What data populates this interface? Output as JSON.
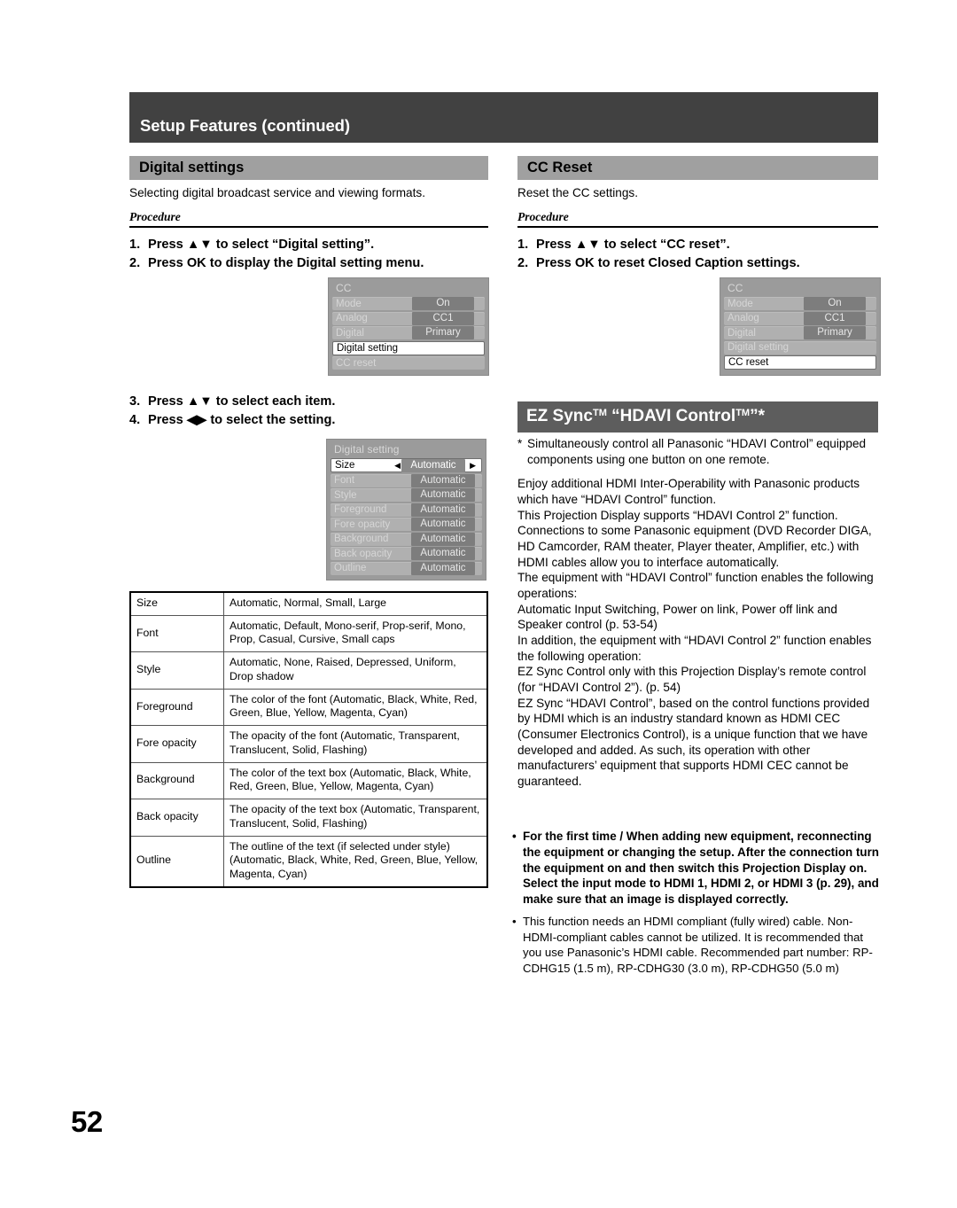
{
  "header": {
    "chapter_title": "Setup Features (continued)"
  },
  "page_number": "52",
  "left_column": {
    "section_title": "Digital settings",
    "description": "Selecting digital broadcast service and viewing formats.",
    "procedure_label": "Procedure",
    "steps_a": [
      {
        "num": "1.",
        "text": "Press ▲▼ to select “Digital setting”."
      },
      {
        "num": "2.",
        "text": "Press OK to display the Digital setting menu."
      }
    ],
    "steps_b": [
      {
        "num": "3.",
        "text": "Press ▲▼ to select each item."
      },
      {
        "num": "4.",
        "text": "Press ◀▶ to select the setting."
      }
    ],
    "cc_menu": {
      "title": "CC",
      "rows": [
        {
          "label": "Mode",
          "value": "On",
          "selected": false
        },
        {
          "label": "Analog",
          "value": "CC1",
          "selected": false
        },
        {
          "label": "Digital",
          "value": "Primary",
          "selected": false
        },
        {
          "label": "Digital setting",
          "value": "",
          "selected": true
        },
        {
          "label": "CC reset",
          "value": "",
          "selected": false
        }
      ]
    },
    "digital_setting_menu": {
      "title": "Digital setting",
      "left_arrow": "◀",
      "right_arrow": "▶",
      "rows": [
        {
          "label": "Size",
          "value": "Automatic",
          "selected": true
        },
        {
          "label": "Font",
          "value": "Automatic",
          "selected": false
        },
        {
          "label": "Style",
          "value": "Automatic",
          "selected": false
        },
        {
          "label": "Foreground",
          "value": "Automatic",
          "selected": false
        },
        {
          "label": "Fore opacity",
          "value": "Automatic",
          "selected": false
        },
        {
          "label": "Background",
          "value": "Automatic",
          "selected": false
        },
        {
          "label": "Back opacity",
          "value": "Automatic",
          "selected": false
        },
        {
          "label": "Outline",
          "value": "Automatic",
          "selected": false
        }
      ]
    },
    "spec_table": {
      "rows": [
        {
          "key": "Size",
          "value": "Automatic, Normal, Small, Large"
        },
        {
          "key": "Font",
          "value": "Automatic, Default, Mono-serif, Prop-serif, Mono, Prop, Casual, Cursive, Small caps"
        },
        {
          "key": "Style",
          "value": "Automatic, None, Raised, Depressed, Uniform, Drop shadow"
        },
        {
          "key": "Foreground",
          "value": "The color of the font (Automatic, Black, White, Red, Green, Blue, Yellow, Magenta, Cyan)"
        },
        {
          "key": "Fore opacity",
          "value": "The opacity of the font (Automatic, Transparent, Translucent, Solid, Flashing)"
        },
        {
          "key": "Background",
          "value": "The color of the text box (Automatic, Black, White, Red, Green, Blue, Yellow, Magenta, Cyan)"
        },
        {
          "key": "Back opacity",
          "value": "The opacity of the text box (Automatic, Transparent, Translucent, Solid, Flashing)"
        },
        {
          "key": "Outline",
          "value": "The outline of the text (if selected under style) (Automatic, Black, White, Red, Green, Blue, Yellow, Magenta, Cyan)"
        }
      ]
    }
  },
  "right_column": {
    "section_title": "CC Reset",
    "description": "Reset the CC settings.",
    "procedure_label": "Procedure",
    "steps": [
      {
        "num": "1.",
        "text": "Press ▲▼ to select “CC reset”."
      },
      {
        "num": "2.",
        "text": "Press OK to reset Closed Caption settings."
      }
    ],
    "cc_menu": {
      "title": "CC",
      "rows": [
        {
          "label": "Mode",
          "value": "On",
          "selected": false
        },
        {
          "label": "Analog",
          "value": "CC1",
          "selected": false
        },
        {
          "label": "Digital",
          "value": "Primary",
          "selected": false
        },
        {
          "label": "Digital setting",
          "value": "",
          "selected": false
        },
        {
          "label": "CC reset",
          "value": "",
          "selected": true
        }
      ]
    },
    "ez_sync": {
      "title_main": "EZ Sync",
      "title_tm1": "TM",
      "title_mid": " “HDAVI Control",
      "title_tm2": "TM",
      "title_end": "”*",
      "footnote_star": "*",
      "footnote_text": "Simultaneously control all Panasonic “HDAVI Control” equipped components using one button on one remote.",
      "paragraphs": [
        "Enjoy additional HDMI Inter-Operability with Panasonic products which have “HDAVI Control” function.",
        "This Projection Display supports “HDAVI Control 2” function.",
        "Connections to some Panasonic equipment (DVD Recorder DIGA, HD Camcorder, RAM theater, Player theater, Amplifier, etc.) with HDMI cables allow you to interface automatically.",
        "The equipment with “HDAVI Control” function enables the following operations:",
        "Automatic Input Switching, Power on link, Power off link and Speaker control (p. 53-54)",
        "In addition, the equipment with “HDAVI Control 2” function enables the following operation:",
        "EZ Sync Control only with this Projection Display’s remote control (for “HDAVI Control 2”). (p. 54)",
        "EZ Sync “HDAVI Control”, based on the control functions provided by HDMI which is an industry standard known as HDMI CEC (Consumer Electronics Control), is a unique function that we have developed and added. As such, its operation with other manufacturers’ equipment that supports HDMI CEC cannot be guaranteed."
      ]
    },
    "notes": [
      {
        "bullet": "•",
        "bold": true,
        "text": "For the first time / When adding new equipment, reconnecting the equipment or changing the setup. After the connection turn the equipment on and then switch this Projection Display on. Select the input mode to HDMI 1, HDMI 2, or HDMI 3 (p. 29), and make sure that an image is displayed correctly."
      },
      {
        "bullet": "•",
        "bold": false,
        "text": "This function needs an HDMI compliant (fully wired) cable. Non-HDMI-compliant cables cannot be utilized. It is recommended that you use Panasonic’s HDMI cable. Recommended part number: RP-CDHG15 (1.5 m), RP-CDHG30 (3.0 m), RP-CDHG50 (5.0 m)"
      }
    ]
  }
}
